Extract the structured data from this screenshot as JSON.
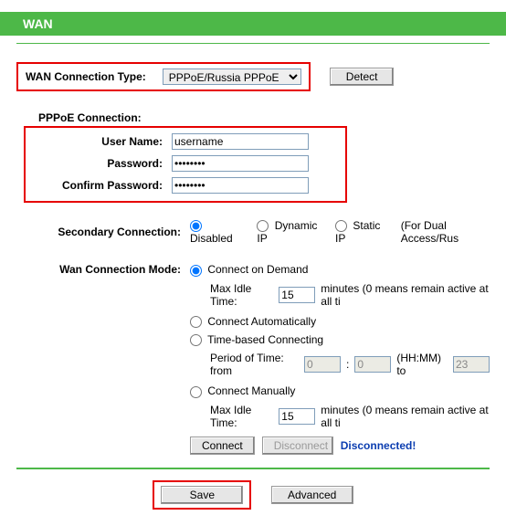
{
  "header": {
    "title": "WAN"
  },
  "connection_type": {
    "label": "WAN Connection Type:",
    "value": "PPPoE/Russia PPPoE",
    "detect_btn": "Detect"
  },
  "pppoe": {
    "title": "PPPoE Connection:",
    "username_label": "User Name:",
    "username_value": "username",
    "password_label": "Password:",
    "password_value": "password",
    "confirm_label": "Confirm Password:",
    "confirm_value": "password"
  },
  "secondary": {
    "label": "Secondary Connection:",
    "disabled": "Disabled",
    "dynamic": "Dynamic IP",
    "static": "Static IP",
    "note": "(For Dual Access/Rus"
  },
  "mode": {
    "label": "Wan Connection Mode:",
    "on_demand": "Connect on Demand",
    "max_idle_label": "Max Idle Time:",
    "max_idle_value": "15",
    "max_idle_suffix": "minutes (0 means remain active at all ti",
    "auto": "Connect Automatically",
    "time_based": "Time-based Connecting",
    "period_label": "Period of Time: from",
    "period_from_h": "0",
    "period_from_m": "0",
    "period_sep": ":",
    "period_fmt": "(HH:MM) to",
    "period_to_h": "23",
    "manual": "Connect Manually",
    "max_idle2_value": "15",
    "connect_btn": "Connect",
    "disconnect_btn": "Disconnect",
    "status": "Disconnected!"
  },
  "footer": {
    "save": "Save",
    "advanced": "Advanced"
  }
}
